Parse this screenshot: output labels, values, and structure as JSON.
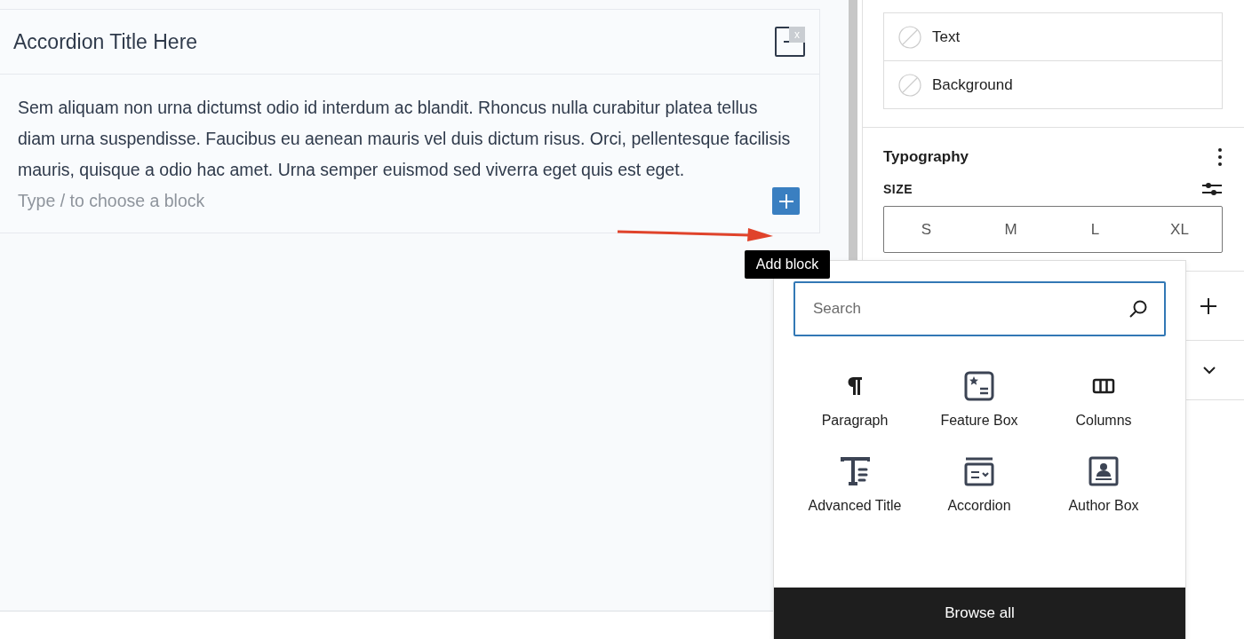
{
  "editor": {
    "accordion_title": "Accordion Title Here",
    "close_badge": "x",
    "paragraph": "Sem aliquam non urna dictumst odio id interdum ac blandit. Rhoncus nulla curabitur platea tellus diam urna suspendisse. Faucibus eu aenean mauris vel duis dictum risus. Orci, pellentesque facilisis mauris, quisque a odio hac amet. Urna semper euismod sed viverra eget quis est eget.",
    "placeholder": "Type / to choose a block"
  },
  "add_block_tooltip": "Add block",
  "sidebar": {
    "color_items": [
      {
        "label": "Text"
      },
      {
        "label": "Background"
      }
    ],
    "typography": {
      "title": "Typography",
      "size_label": "SIZE",
      "sizes": [
        "S",
        "M",
        "L",
        "XL"
      ]
    }
  },
  "inserter": {
    "search": {
      "placeholder": "Search"
    },
    "blocks": [
      {
        "label": "Paragraph",
        "kind": "paragraph"
      },
      {
        "label": "Feature Box",
        "kind": "feature"
      },
      {
        "label": "Columns",
        "kind": "columns"
      },
      {
        "label": "Advanced Title",
        "kind": "title"
      },
      {
        "label": "Accordion",
        "kind": "accordion"
      },
      {
        "label": "Author Box",
        "kind": "author"
      }
    ],
    "browse_all": "Browse all"
  }
}
